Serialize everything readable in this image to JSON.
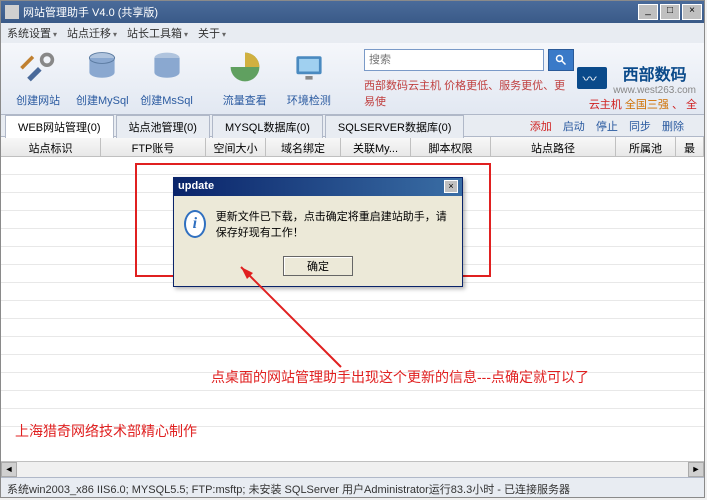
{
  "window": {
    "title": "网站管理助手  V4.0  (共享版)"
  },
  "menu": {
    "settings": "系统设置",
    "migrate": "站点迁移",
    "tools": "站长工具箱",
    "about": "关于"
  },
  "toolbar": {
    "create_site": "创建网站",
    "create_mysql": "创建MySql",
    "create_mssql": "创建MsSql",
    "traffic": "流量查看",
    "env_check": "环境检测"
  },
  "search": {
    "placeholder": "搜索"
  },
  "promo": {
    "text": "西部数码云主机  价格更低、服务更优、更易使"
  },
  "brand": {
    "name": "西部数码",
    "url": "www.west263.com"
  },
  "cloud_host": {
    "label": "云主机",
    "slogan": "全国三强",
    "tail": "、 全"
  },
  "tabs": {
    "web": "WEB网站管理(0)",
    "pool": "站点池管理(0)",
    "mysql": "MYSQL数据库(0)",
    "sqlserver": "SQLSERVER数据库(0)"
  },
  "actions": {
    "add": "添加",
    "start": "启动",
    "stop": "停止",
    "sync": "同步",
    "del": "删除"
  },
  "grid": {
    "cols": [
      "站点标识",
      "FTP账号",
      "空间大小",
      "域名绑定",
      "关联My...",
      "脚本权限",
      "站点路径",
      "所属池",
      "最"
    ]
  },
  "dialog": {
    "title": "update",
    "message": "更新文件已下载，点击确定将重启建站助手，请保存好现有工作！",
    "ok": "确定"
  },
  "annotation": "点桌面的网站管理助手出现这个更新的信息---点确定就可以了",
  "watermark": "上海猎奇网络技术部精心制作",
  "status": "系统win2003_x86 IIS6.0; MYSQL5.5; FTP:msftp;  未安装 SQLServer 用户Administrator运行83.3小时 - 已连接服务器"
}
